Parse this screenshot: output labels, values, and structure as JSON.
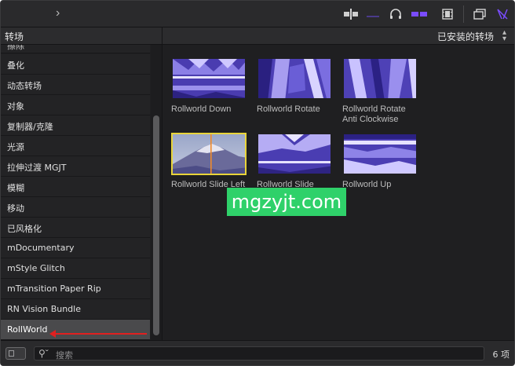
{
  "toolbar": {
    "icons": [
      "chevron-right-icon",
      "clip-trim-icon",
      "audio-waveform-icon",
      "headphones-icon",
      "snapping-icon",
      "video-clip-icon",
      "browser-icon",
      "effects-icon"
    ],
    "accent": "#6f3fff"
  },
  "browser": {
    "category_title": "转场",
    "filter_label": "已安装的转场",
    "partial_item": "擦除"
  },
  "sidebar": {
    "items": [
      {
        "label": "叠化"
      },
      {
        "label": "动态转场"
      },
      {
        "label": "对象"
      },
      {
        "label": "复制器/克隆"
      },
      {
        "label": "光源"
      },
      {
        "label": "拉伸过渡 MGJT"
      },
      {
        "label": "模糊"
      },
      {
        "label": "移动"
      },
      {
        "label": "已风格化"
      },
      {
        "label": "mDocumentary"
      },
      {
        "label": "mStyle Glitch"
      },
      {
        "label": "mTransition Paper Rip"
      },
      {
        "label": "RN Vision Bundle"
      },
      {
        "label": "RollWorld",
        "selected": true
      }
    ]
  },
  "transitions": [
    {
      "name": "Rollworld Down"
    },
    {
      "name": "Rollworld Rotate"
    },
    {
      "name": "Rollworld Rotate Anti Clockwise"
    },
    {
      "name": "Rollworld Slide Left",
      "selected": true
    },
    {
      "name": "Rollworld Slide"
    },
    {
      "name": "Rollworld Up"
    }
  ],
  "watermark": "mgzyjt.com",
  "search": {
    "placeholder": "搜索"
  },
  "status": {
    "count": "6 项"
  },
  "colors": {
    "selection_border": "#e8d43a",
    "watermark_bg": "#2fd16a",
    "annotation_arrow": "#e02020"
  }
}
